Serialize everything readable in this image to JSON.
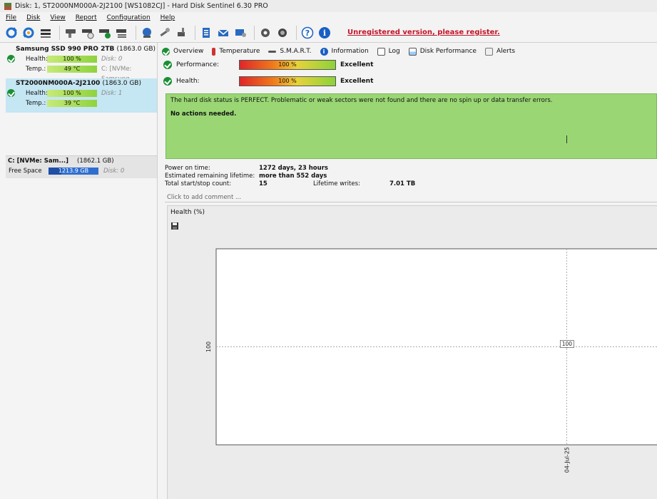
{
  "titlebar": {
    "title": "Disk: 1, ST2000NM000A-2J2100 [WS1082CJ]  -  Hard Disk Sentinel 6.30 PRO"
  },
  "menu": [
    "File",
    "Disk",
    "View",
    "Report",
    "Configuration",
    "Help"
  ],
  "toolbar": {
    "register_text": "Unregistered version, please register."
  },
  "disks": [
    {
      "name": "Samsung SSD 990 PRO 2TB",
      "capacity": "(1863.0 GB)",
      "health_label": "Health:",
      "health": "100 %",
      "health_extra": "Disk: 0",
      "temp_label": "Temp.:",
      "temp": "49 °C",
      "temp_extra": "C: [NVMe: Samsung"
    },
    {
      "name": "ST2000NM000A-2J2100",
      "capacity": "(1863.0 GB)",
      "health_label": "Health:",
      "health": "100 %",
      "health_extra": "Disk: 1",
      "temp_label": "Temp.:",
      "temp": "39 °C"
    }
  ],
  "volume": {
    "name": "C: [NVMe: Sam...]",
    "capacity": "(1862.1 GB)",
    "free_label": "Free Space",
    "free": "1213.9 GB",
    "disk": "Disk: 0"
  },
  "tabs": [
    "Overview",
    "Temperature",
    "S.M.A.R.T.",
    "Information",
    "Log",
    "Disk Performance",
    "Alerts"
  ],
  "overview": {
    "performance_label": "Performance:",
    "performance_value": "100 %",
    "performance_verdict": "Excellent",
    "health_label": "Health:",
    "health_value": "100 %",
    "health_verdict": "Excellent",
    "status_line1": "The hard disk status is PERFECT. Problematic or weak sectors were not found and there are no spin up or data transfer errors.",
    "status_line2": "No actions needed.",
    "power_on_label": "Power on time:",
    "power_on_value": "1272 days, 23 hours",
    "remaining_label": "Estimated remaining lifetime:",
    "remaining_value": "more than 552 days",
    "startstop_label": "Total start/stop count:",
    "startstop_value": "15",
    "lifetime_writes_label": "Lifetime writes:",
    "lifetime_writes_value": "7.01 TB",
    "comment_placeholder": "Click to add comment ..."
  },
  "colors": {
    "status_green": "#9ad774",
    "register_red": "#c3152a",
    "selection_blue": "#c5e6f3"
  },
  "chart_data": {
    "type": "line",
    "title": "Health (%)",
    "x": [
      "04-Jul-25"
    ],
    "series": [
      {
        "values": [
          100
        ]
      }
    ],
    "ytick_labels": [
      "100"
    ],
    "data_labels": [
      "100"
    ],
    "grid": true
  }
}
